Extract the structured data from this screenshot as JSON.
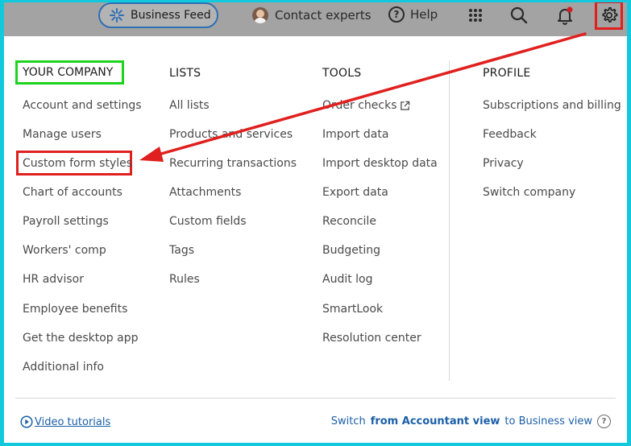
{
  "topbar": {
    "business_feed": "Business Feed",
    "contact_experts": "Contact experts",
    "help": "Help"
  },
  "menu": {
    "your_company": {
      "heading": "YOUR COMPANY",
      "items": [
        "Account and settings",
        "Manage users",
        "Custom form styles",
        "Chart of accounts",
        "Payroll settings",
        "Workers' comp",
        "HR advisor",
        "Employee benefits",
        "Get the desktop app",
        "Additional info"
      ]
    },
    "lists": {
      "heading": "LISTS",
      "items": [
        "All lists",
        "Products and services",
        "Recurring transactions",
        "Attachments",
        "Custom fields",
        "Tags",
        "Rules"
      ]
    },
    "tools": {
      "heading": "TOOLS",
      "items": [
        "Order checks",
        "Import data",
        "Import desktop data",
        "Export data",
        "Reconcile",
        "Budgeting",
        "Audit log",
        "SmartLook",
        "Resolution center"
      ]
    },
    "profile": {
      "heading": "PROFILE",
      "items": [
        "Subscriptions and billing",
        "Feedback",
        "Privacy",
        "Switch company"
      ]
    }
  },
  "footer": {
    "video_tutorials": "Video tutorials",
    "switch_prefix": "Switch",
    "switch_bold": "from Accountant view",
    "switch_suffix": "to Business view"
  },
  "colors": {
    "annotation_red": "#e0201e",
    "annotation_green": "#1ed31e",
    "link_blue": "#1b5fa8",
    "page_border": "#12c8dc"
  },
  "icons": [
    "business-feed-icon",
    "apps-grid-icon",
    "search-icon",
    "bell-icon",
    "gear-icon",
    "external-link-icon",
    "play-circle-icon",
    "help-circle-icon"
  ]
}
